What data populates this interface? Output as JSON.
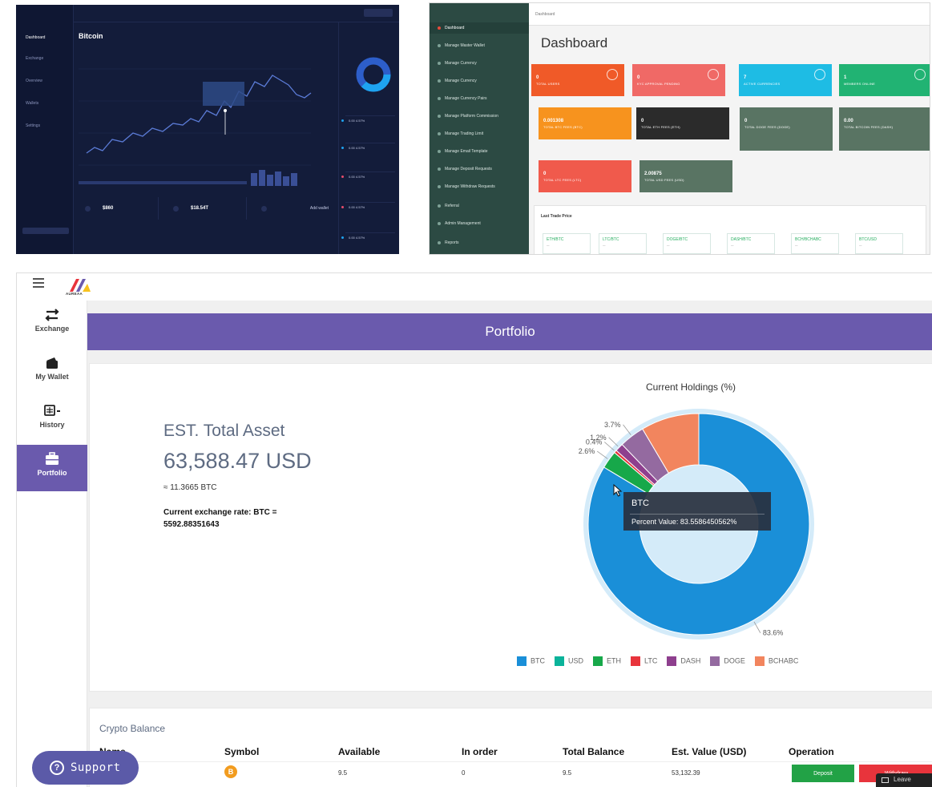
{
  "thumb_dark": {
    "title": "Bitcoin",
    "sidebar": [
      "Dashboard",
      "Exchange",
      "Overview",
      "Wallets",
      "Settings"
    ],
    "cards": [
      "$860",
      "$18.54T",
      "Add wallet"
    ],
    "right_rows": [
      "0.00 4.57%",
      "0.00 4.57%",
      "0.00 4.57%",
      "0.00 4.57%",
      "0.00 4.57%"
    ]
  },
  "thumb_admin": {
    "breadcrumb": "Dashboard",
    "heading": "Dashboard",
    "sidebar": [
      "Dashboard",
      "Manage Master Wallet",
      "Manage Currency",
      "Manage Currency",
      "Manage Currency Pairs",
      "Manage Platform Commission",
      "Manage Trading Limit",
      "Manage Email Template",
      "Manage Deposit Requests",
      "Manage Withdraw Requests",
      "Referral",
      "Admin Management",
      "Reports"
    ],
    "tiles": [
      {
        "value": "0",
        "label": "Total Users",
        "color": "#f05a28"
      },
      {
        "value": "0",
        "label": "KYC Approval Pending",
        "color": "#f06966"
      },
      {
        "value": "7",
        "label": "Active Currencies",
        "color": "#1ebce4"
      },
      {
        "value": "1",
        "label": "Members Online",
        "color": "#21b373"
      },
      {
        "value": "0.001308",
        "label": "Total BTC Fees (BTC)",
        "color": "#f7931e"
      },
      {
        "value": "0",
        "label": "Total ETH Fees (ETH)",
        "color": "#2b2b2b"
      },
      {
        "value": "0",
        "label": "Total Doge Fees (DOGE)",
        "color": "#597463"
      },
      {
        "value": "0.00",
        "label": "Total Bitcoin Fees (DASH)",
        "color": "#597463"
      },
      {
        "value": "0",
        "label": "Total LTC Fees (LTC)",
        "color": "#f05a4c"
      },
      {
        "value": "2.00875",
        "label": "Total USD Fees (USD)",
        "color": "#597463"
      }
    ],
    "last_trade_title": "Last Trade Price",
    "pairs": [
      "ETH/BTC",
      "LTC/BTC",
      "DOGE/BTC",
      "DASH/BTC",
      "BCH/BCHABC",
      "BTC/USD"
    ]
  },
  "app": {
    "brand": "AUREAA",
    "nav": [
      "Exchange",
      "My Wallet",
      "History",
      "Portfolio"
    ],
    "banner": "Portfolio",
    "est_label": "EST. Total Asset",
    "est_value": "63,588.47 USD",
    "est_btc": "≈ 11.3665 BTC",
    "exchange_rate": "Current exchange rate: BTC = 5592.88351643",
    "tooltip": {
      "title": "BTC",
      "body": "Percent Value: 83.5586450562%"
    },
    "balance": {
      "title": "Crypto Balance",
      "columns": [
        "Name",
        "Symbol",
        "Available",
        "In order",
        "Total Balance",
        "Est. Value (USD)",
        "Operation"
      ],
      "row": {
        "symbol": "B",
        "available": "9.5",
        "in_order": "0",
        "total": "9.5",
        "est_value": "53,132.39"
      },
      "deposit_label": "Deposit",
      "withdraw_label": "Withdraw"
    },
    "chat_label": "Leave",
    "support_label": "Support"
  },
  "chart_data": {
    "type": "pie",
    "title": "Current Holdings (%)",
    "categories": [
      "BTC",
      "USD",
      "ETH",
      "LTC",
      "DASH",
      "DOGE",
      "BCHABC"
    ],
    "values": [
      83.6,
      0,
      2.6,
      0.4,
      1.2,
      3.7,
      8.5
    ],
    "display_labels": [
      "83.6%",
      "",
      "2.6%",
      "0.4%",
      "1.2%",
      "3.7%",
      ""
    ],
    "colors": [
      "#1a8fd8",
      "#0bb39a",
      "#17a84a",
      "#e8343c",
      "#8e3f8e",
      "#946aa0",
      "#f2855e"
    ],
    "donut": true,
    "legend": "bottom"
  }
}
